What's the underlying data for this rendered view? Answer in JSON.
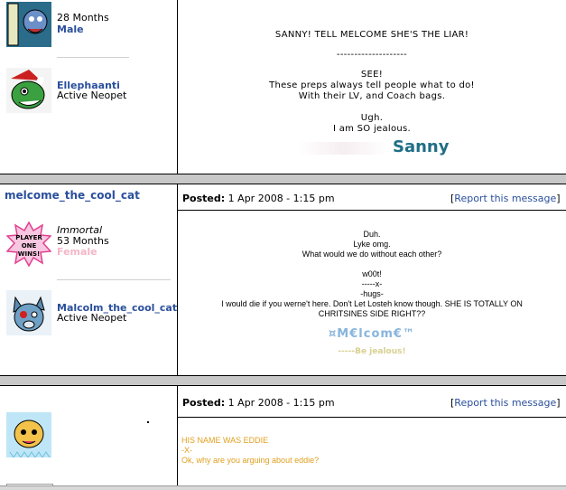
{
  "post1": {
    "user_top": {
      "months": "28 Months",
      "gender": "Male"
    },
    "pet": {
      "name": "Ellephaanti",
      "status": "Active Neopet"
    },
    "body": {
      "line1": "SANNY! TELL MELCOME SHE'S THE LIAR!",
      "divider": "--------------------",
      "line2": "SEE!",
      "line3": "These preps always tell people what to do!",
      "line4": "With their LV, and Coach bags.",
      "line5": "Ugh.",
      "line6": "I am SO jealous.",
      "signature": "Sanny"
    }
  },
  "post2": {
    "username": "melcome_the_cool_cat",
    "avatar_text": "PLAYER ONE WINS!",
    "user": {
      "title": "Immortal",
      "months": "53 Months",
      "gender": "Female"
    },
    "pet": {
      "name": "Malcolm_the_cool_cat",
      "status": "Active Neopet"
    },
    "posted_label": "Posted:",
    "posted_date": "1 Apr 2008 - 1:15 pm",
    "report": "Report this message",
    "body": {
      "l1": "Duh.",
      "l2": "Lyke omg.",
      "l3": "What would we do without each other?",
      "l4": "w00t!",
      "l5": "-----x-",
      "l6": "-hugs-",
      "l7": "I would die if you werne't here. Don't Let Losteh know though. SHE IS TOTALLY ON",
      "l8": "CHRITSINES SIDE RIGHT??",
      "signature": "¤M€lcom€™",
      "signature_sub": "-----Be jealous!"
    }
  },
  "post3": {
    "posted_label": "Posted:",
    "posted_date": "1 Apr 2008 - 1:15 pm",
    "report": "Report this message",
    "body": {
      "l1": "HIS NAME WAS EDDIE",
      "l2": "-X-",
      "l3": "Ok, why are you arguing about eddie?"
    },
    "colors": {
      "body_text": "#e0a020"
    }
  },
  "colors": {
    "link": "#2a4f9c",
    "sanny": "#1f6e86",
    "female": "#f3b6c8",
    "signature": "#88b5dd"
  }
}
